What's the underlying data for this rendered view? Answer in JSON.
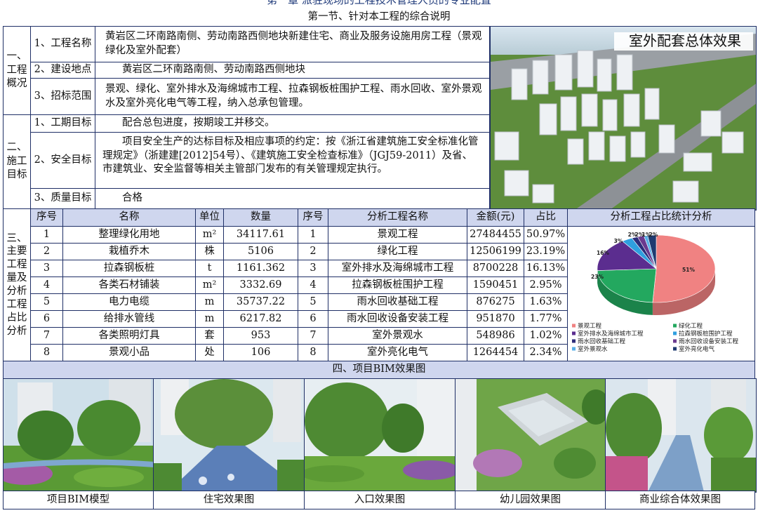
{
  "header": {
    "chapter_title": "第一章 派驻现场的工程技术管理人员的专业配置",
    "section_title": "第一节、针对本工程的综合说明"
  },
  "overview": {
    "group_label_lines": [
      "一、",
      "工程",
      "概况"
    ],
    "rows": [
      {
        "label": "1、工程名称",
        "value": "黄岩区二环南路南侧、劳动南路西侧地块新建住宅、商业及服务设施用房工程（景观绿化及室外配套）"
      },
      {
        "label": "2、建设地点",
        "value": "黄岩区二环南路南侧、劳动南路西侧地块"
      },
      {
        "label": "3、招标范围",
        "value": "景观、绿化、室外排水及海绵城市工程、拉森钢板桩围护工程、雨水回收、室外景观水及室外亮化电气等工程，纳入总承包管理。"
      }
    ]
  },
  "goals": {
    "group_label_lines": [
      "二、",
      "施工",
      "目标"
    ],
    "rows": [
      {
        "label": "1、工期目标",
        "value": "配合总包进度，按期竣工并移交。"
      },
      {
        "label": "2、安全目标",
        "value": "项目安全生产的达标目标及相应事项的约定：按《浙江省建筑施工安全标准化管理规定》（浙建建[2012]54号）、《建筑施工安全检查标准》（JGJ59-2011）及省、市建筑业、安全监督等相关主管部门发布的有关管理规定执行。"
      },
      {
        "label": "3、质量目标",
        "value": "合格"
      }
    ]
  },
  "render_panel": {
    "title": "室外配套总体效果"
  },
  "quantities": {
    "group_label_lines": [
      "三、",
      "主要",
      "工程",
      "量及",
      "分析",
      "工程",
      "占比",
      "分析"
    ],
    "headers": [
      "序号",
      "名称",
      "单位",
      "数量"
    ],
    "rows": [
      {
        "no": "1",
        "name": "整理绿化用地",
        "unit": "m²",
        "qty": "34117.61"
      },
      {
        "no": "2",
        "name": "栽植乔木",
        "unit": "株",
        "qty": "5106"
      },
      {
        "no": "3",
        "name": "拉森钢板桩",
        "unit": "t",
        "qty": "1161.362"
      },
      {
        "no": "4",
        "name": "各类石材铺装",
        "unit": "m²",
        "qty": "3332.69"
      },
      {
        "no": "5",
        "name": "电力电缆",
        "unit": "m",
        "qty": "35737.22"
      },
      {
        "no": "6",
        "name": "给排水管线",
        "unit": "m",
        "qty": "6217.82"
      },
      {
        "no": "7",
        "name": "各类照明灯具",
        "unit": "套",
        "qty": "953"
      },
      {
        "no": "8",
        "name": "景观小品",
        "unit": "处",
        "qty": "106"
      }
    ]
  },
  "analysis": {
    "headers": [
      "序号",
      "分析工程名称",
      "金额(元)",
      "占比"
    ],
    "rows": [
      {
        "no": "1",
        "name": "景观工程",
        "amount": "27484455",
        "ratio": "50.97%"
      },
      {
        "no": "2",
        "name": "绿化工程",
        "amount": "12506199",
        "ratio": "23.19%"
      },
      {
        "no": "3",
        "name": "室外排水及海绵城市工程",
        "amount": "8700228",
        "ratio": "16.13%"
      },
      {
        "no": "4",
        "name": "拉森钢板桩围护工程",
        "amount": "1590451",
        "ratio": "2.95%"
      },
      {
        "no": "5",
        "name": "雨水回收基础工程",
        "amount": "876275",
        "ratio": "1.63%"
      },
      {
        "no": "6",
        "name": "雨水回收设备安装工程",
        "amount": "951870",
        "ratio": "1.77%"
      },
      {
        "no": "7",
        "name": "室外景观水",
        "amount": "548986",
        "ratio": "1.02%"
      },
      {
        "no": "8",
        "name": "室外亮化电气",
        "amount": "1264454",
        "ratio": "2.34%"
      }
    ]
  },
  "chart_panel": {
    "title": "分析工程占比统计分析"
  },
  "chart_data": {
    "type": "pie",
    "title": "分析工程占比统计分析",
    "categories": [
      "景观工程",
      "绿化工程",
      "室外排水及海绵城市工程",
      "拉森钢板桩围护工程",
      "雨水回收基础工程",
      "雨水回收设备安装工程",
      "室外景观水",
      "室外亮化电气"
    ],
    "values": [
      50.97,
      23.19,
      16.13,
      2.95,
      1.63,
      1.77,
      1.02,
      2.34
    ],
    "data_labels": [
      "51%",
      "23%",
      "16%",
      "3%",
      "2%",
      "2%",
      "1%",
      "2%"
    ],
    "colors": [
      "#f08282",
      "#23a85f",
      "#5b2d8f",
      "#2f9fdf",
      "#2d2d7a",
      "#6a3a8f",
      "#5ab0e8",
      "#1e3a70"
    ],
    "legend_placement": "bottom"
  },
  "bim": {
    "title": "四、项目BIM效果图",
    "captions": [
      "项目BIM模型",
      "住宅效果图",
      "入口效果图",
      "幼儿园效果图",
      "商业综合体效果图"
    ]
  },
  "colors": {
    "border": "#1f2f66",
    "header_fill": "#cfd6ee",
    "title_blue": "#1f3a7a"
  }
}
